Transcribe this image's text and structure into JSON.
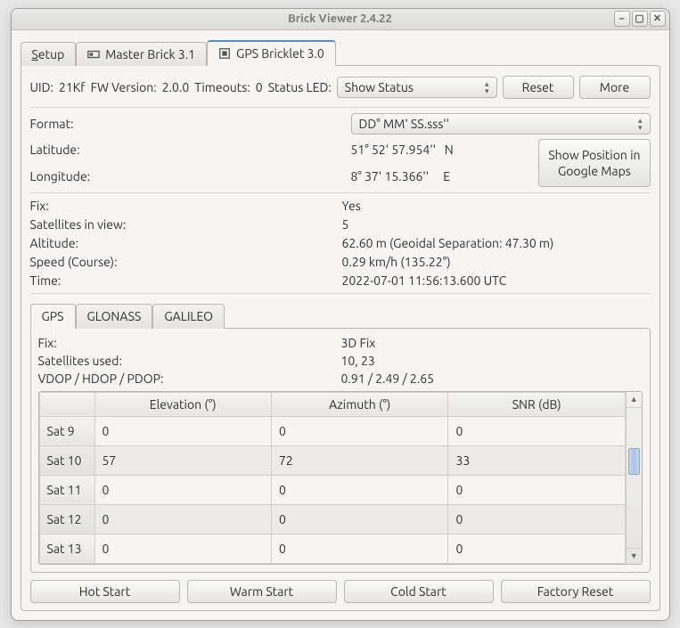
{
  "window": {
    "title": "Brick Viewer 2.4.22"
  },
  "tabs": {
    "setup": "Setup",
    "master": "Master Brick 3.1",
    "gps": "GPS Bricklet 3.0"
  },
  "header": {
    "uid_label": "UID:",
    "uid_value": "21Kf",
    "fw_label": "FW Version:",
    "fw_value": "2.0.0",
    "timeouts_label": "Timeouts:",
    "timeouts_value": "0",
    "statusled_label": "Status LED:",
    "statusled_value": "Show Status",
    "reset": "Reset",
    "more": "More"
  },
  "info": {
    "format_label": "Format:",
    "format_value": "DD° MM' SS.sss''",
    "lat_label": "Latitude:",
    "lat_value": "51° 52' 57.954''",
    "lat_dir": "N",
    "lon_label": "Longitude:",
    "lon_value": "8° 37' 15.366''",
    "lon_dir": "E",
    "maps_btn_l1": "Show Position in",
    "maps_btn_l2": "Google Maps"
  },
  "status": {
    "fix_label": "Fix:",
    "fix_value": "Yes",
    "satsview_label": "Satellites in view:",
    "satsview_value": "5",
    "alt_label": "Altitude:",
    "alt_value": "62.60 m (Geoidal Separation: 47.30 m)",
    "speed_label": "Speed (Course):",
    "speed_value": "0.29 km/h  (135.22°)",
    "time_label": "Time:",
    "time_value": "2022-07-01 11:56:13.600 UTC"
  },
  "subtabs": {
    "gps": "GPS",
    "glonass": "GLONASS",
    "galileo": "GALILEO"
  },
  "gps_detail": {
    "fix_label": "Fix:",
    "fix_value": "3D Fix",
    "satsused_label": "Satellites used:",
    "satsused_value": "10, 23",
    "dop_label": "VDOP / HDOP / PDOP:",
    "dop_value": "0.91 / 2.49 / 2.65",
    "columns": {
      "elevation": "Elevation (°)",
      "azimuth": "Azimuth (°)",
      "snr": "SNR (dB)"
    },
    "rows": [
      {
        "sat": "Sat 9",
        "elevation": "0",
        "azimuth": "0",
        "snr": "0"
      },
      {
        "sat": "Sat 10",
        "elevation": "57",
        "azimuth": "72",
        "snr": "33"
      },
      {
        "sat": "Sat 11",
        "elevation": "0",
        "azimuth": "0",
        "snr": "0"
      },
      {
        "sat": "Sat 12",
        "elevation": "0",
        "azimuth": "0",
        "snr": "0"
      },
      {
        "sat": "Sat 13",
        "elevation": "0",
        "azimuth": "0",
        "snr": "0"
      }
    ]
  },
  "footer": {
    "hot": "Hot Start",
    "warm": "Warm Start",
    "cold": "Cold Start",
    "factory": "Factory Reset"
  }
}
